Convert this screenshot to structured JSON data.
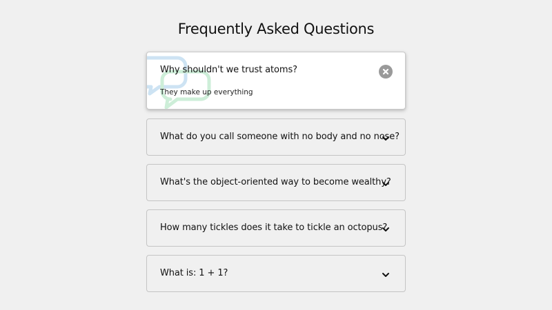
{
  "page": {
    "title": "Frequently Asked Questions"
  },
  "faq": {
    "items": [
      {
        "question": "Why shouldn't we trust atoms?",
        "answer": "They make up everything",
        "expanded": true,
        "toggle_icon": "close-icon"
      },
      {
        "question": "What do you call someone with no body and no nose?",
        "expanded": false,
        "toggle_icon": "chevron-down-icon"
      },
      {
        "question": "What's the object-oriented way to become wealthy?",
        "expanded": false,
        "toggle_icon": "chevron-down-icon"
      },
      {
        "question": "How many tickles does it take to tickle an octopus?",
        "expanded": false,
        "toggle_icon": "chevron-down-icon"
      },
      {
        "question": "What is: 1 + 1?",
        "expanded": false,
        "toggle_icon": "chevron-down-icon"
      }
    ]
  },
  "colors": {
    "background": "#f0f0f0",
    "card_active": "#ffffff",
    "border": "#c4c4c4",
    "close_button": "#9a9a9a",
    "bubble_blue": "#cde3f3",
    "bubble_green": "#cdeed8"
  }
}
